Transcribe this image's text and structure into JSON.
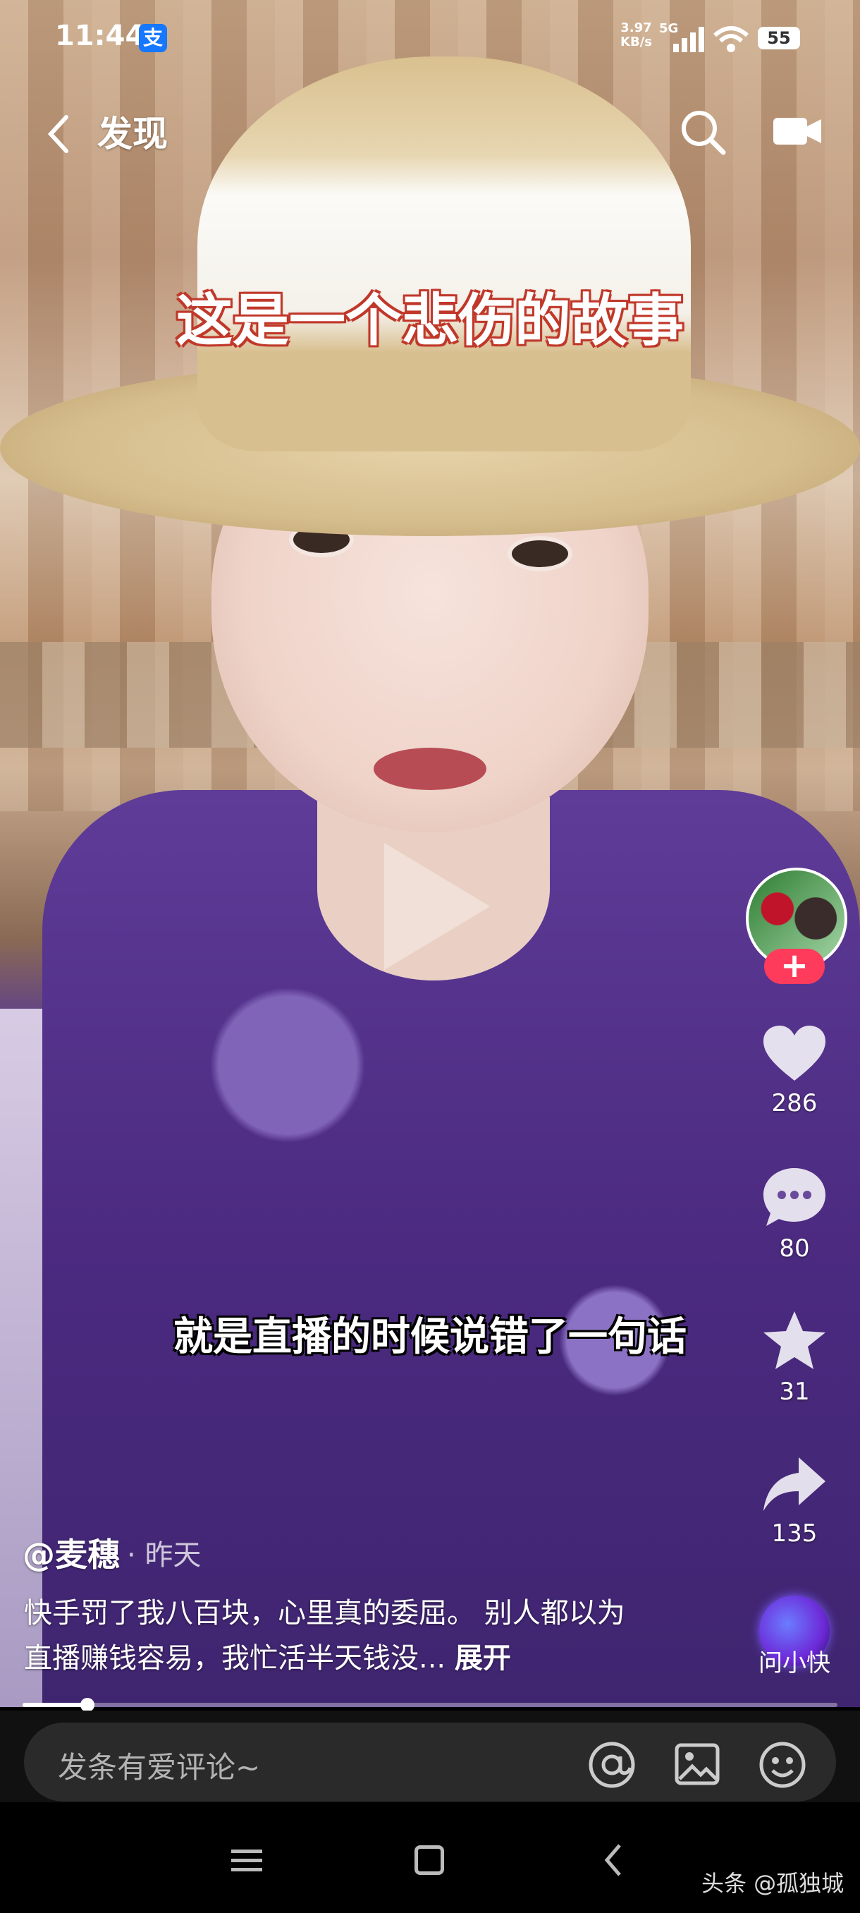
{
  "status_bar": {
    "time": "11:44",
    "app_badge": "支",
    "net_speed_value": "3.97",
    "net_speed_unit": "KB/s",
    "network_type": "5G",
    "battery": "55"
  },
  "top_nav": {
    "title": "发现",
    "back_icon": "chevron-left-icon",
    "search_icon": "search-icon",
    "camera_icon": "video-camera-icon"
  },
  "video": {
    "overlay_title": "这是一个悲伤的故事",
    "subtitle": "就是直播的时候说错了一句话",
    "state": "paused",
    "progress_fraction": 0.08
  },
  "rail": {
    "follow_label": "+",
    "likes": "286",
    "comments": "80",
    "favorites": "31",
    "shares": "135",
    "ask_label": "问小快"
  },
  "post": {
    "author": "@麦穗",
    "separator": "·",
    "time": "昨天",
    "description": "快手罚了我八百块，心里真的委屈。 别人都以为直播赚钱容易，我忙活半天钱没... ",
    "expand_label": "展开"
  },
  "comment_bar": {
    "placeholder": "发条有爱评论~"
  },
  "watermark": "头条 @孤独城",
  "colors": {
    "follow_button": "#ff3b5c",
    "overlay_title_stroke": "#c0392b",
    "background": "#000000"
  }
}
